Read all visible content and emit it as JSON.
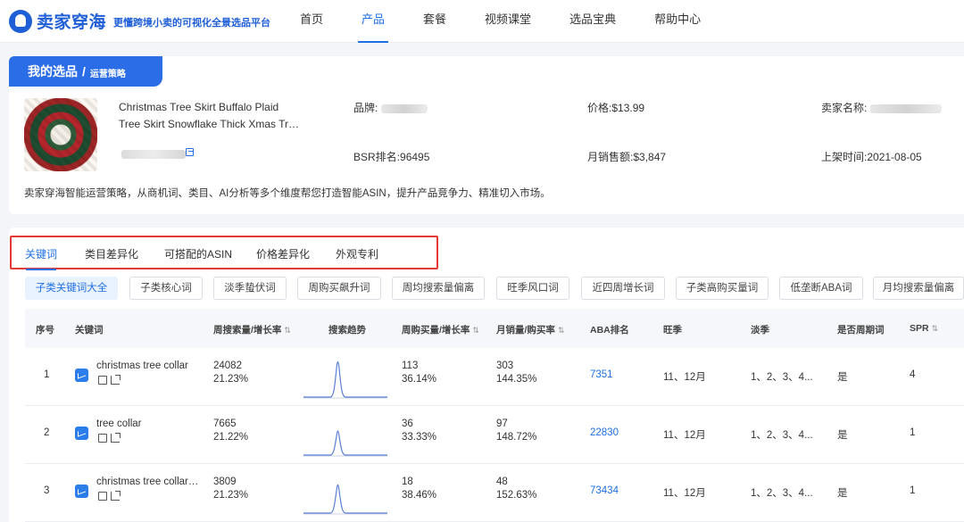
{
  "header": {
    "logo_name": "卖家穿海",
    "slogan": "更懂跨境小卖的可视化全景选品平台",
    "nav": [
      {
        "label": "首页",
        "active": false
      },
      {
        "label": "产品",
        "active": true
      },
      {
        "label": "套餐",
        "active": false
      },
      {
        "label": "视频课堂",
        "active": false
      },
      {
        "label": "选品宝典",
        "active": false
      },
      {
        "label": "帮助中心",
        "active": false
      }
    ]
  },
  "breadcrumb": {
    "main": "我的选品",
    "separator": "/",
    "sub": "运营策略"
  },
  "product": {
    "title_line1": "Christmas Tree Skirt Buffalo Plaid",
    "title_line2": "Tree Skirt Snowflake Thick Xmas Tr…",
    "brand_label": "品牌:",
    "price_label": "价格:",
    "price_value": "$13.99",
    "seller_label": "卖家名称:",
    "bsr_label": "BSR排名:",
    "bsr_value": "96495",
    "monthly_sales_label": "月销售额:",
    "monthly_sales_value": "$3,847",
    "listed_label": "上架时间:",
    "listed_value": "2021-08-05",
    "description": "卖家穿海智能运营策略，从商机词、类目、AI分析等多个维度帮您打造智能ASIN，提升产品竞争力、精准切入市场。"
  },
  "tabs": [
    {
      "label": "关键词",
      "active": true
    },
    {
      "label": "类目差异化",
      "active": false
    },
    {
      "label": "可搭配的ASIN",
      "active": false
    },
    {
      "label": "价格差异化",
      "active": false
    },
    {
      "label": "外观专利",
      "active": false
    }
  ],
  "filters": [
    {
      "label": "子类关键词大全",
      "active": true
    },
    {
      "label": "子类核心词",
      "active": false
    },
    {
      "label": "淡季蛰伏词",
      "active": false
    },
    {
      "label": "周购买飙升词",
      "active": false
    },
    {
      "label": "周均搜索量偏离",
      "active": false
    },
    {
      "label": "旺季风口词",
      "active": false
    },
    {
      "label": "近四周增长词",
      "active": false
    },
    {
      "label": "子类高购买量词",
      "active": false
    },
    {
      "label": "低垄断ABA词",
      "active": false
    },
    {
      "label": "月均搜索量偏离",
      "active": false
    }
  ],
  "table": {
    "columns": {
      "index": "序号",
      "keyword": "关键词",
      "weekly_search": "周搜索量/增长率",
      "trend": "搜索趋势",
      "weekly_buy": "周购买量/增长率",
      "monthly_sales": "月销量/购买率",
      "aba_rank": "ABA排名",
      "peak": "旺季",
      "off": "淡季",
      "periodic": "是否周期词",
      "spr": "SPR"
    },
    "rows": [
      {
        "index": "1",
        "keyword": "christmas tree collar",
        "search": "24082",
        "search_rate": "21.23%",
        "buy": "113",
        "buy_rate": "36.14%",
        "sales": "303",
        "sales_rate": "144.35%",
        "aba": "7351",
        "peak": "11、12月",
        "off": "1、2、3、4...",
        "periodic": "是",
        "spr": "4"
      },
      {
        "index": "2",
        "keyword": "tree collar",
        "search": "7665",
        "search_rate": "21.22%",
        "buy": "36",
        "buy_rate": "33.33%",
        "sales": "97",
        "sales_rate": "148.72%",
        "aba": "22830",
        "peak": "11、12月",
        "off": "1、2、3、4...",
        "periodic": "是",
        "spr": "1"
      },
      {
        "index": "3",
        "keyword": "christmas tree collar…",
        "search": "3809",
        "search_rate": "21.23%",
        "buy": "18",
        "buy_rate": "38.46%",
        "sales": "48",
        "sales_rate": "152.63%",
        "aba": "73434",
        "peak": "11、12月",
        "off": "1、2、3、4...",
        "periodic": "是",
        "spr": "1"
      }
    ]
  },
  "colors": {
    "accent": "#1f6fe5",
    "highlight_border": "#e53935"
  }
}
